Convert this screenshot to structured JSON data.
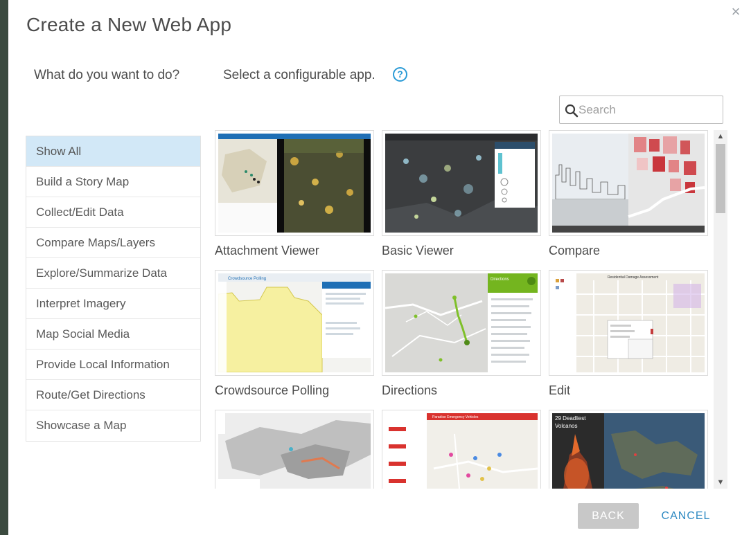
{
  "dialog": {
    "title": "Create a New Web App",
    "close_icon": "close-icon"
  },
  "prompts": {
    "left": "What do you want to do?",
    "right": "Select a configurable app.",
    "help_icon": "help-icon",
    "help_glyph": "?"
  },
  "search": {
    "placeholder": "Search",
    "icon": "search-icon"
  },
  "categories": [
    {
      "label": "Show All",
      "active": true
    },
    {
      "label": "Build a Story Map",
      "active": false
    },
    {
      "label": "Collect/Edit Data",
      "active": false
    },
    {
      "label": "Compare Maps/Layers",
      "active": false
    },
    {
      "label": "Explore/Summarize Data",
      "active": false
    },
    {
      "label": "Interpret Imagery",
      "active": false
    },
    {
      "label": "Map Social Media",
      "active": false
    },
    {
      "label": "Provide Local Information",
      "active": false
    },
    {
      "label": "Route/Get Directions",
      "active": false
    },
    {
      "label": "Showcase a Map",
      "active": false
    }
  ],
  "apps": [
    {
      "label": "Attachment Viewer"
    },
    {
      "label": "Basic Viewer"
    },
    {
      "label": "Compare"
    },
    {
      "label": "Crowdsource Polling"
    },
    {
      "label": "Directions"
    },
    {
      "label": "Edit"
    },
    {
      "label": ""
    },
    {
      "label": ""
    },
    {
      "label": ""
    }
  ],
  "thumb_text": {
    "crowdsource_header": "Crowdsource Polling",
    "directions_header": "Directions",
    "edit_header": "Residential Damage Assessment",
    "row3_c_header": "Paradise Emergency Vehicles",
    "volcano_title_1": "29 Deadliest",
    "volcano_title_2": "Volcanos"
  },
  "footer": {
    "back_label": "BACK",
    "cancel_label": "CANCEL"
  },
  "colors": {
    "accent": "#2b9bd6",
    "active_category": "#d2e8f7",
    "back_button": "#c8c8c8",
    "cancel_text": "#2f8ac2"
  }
}
